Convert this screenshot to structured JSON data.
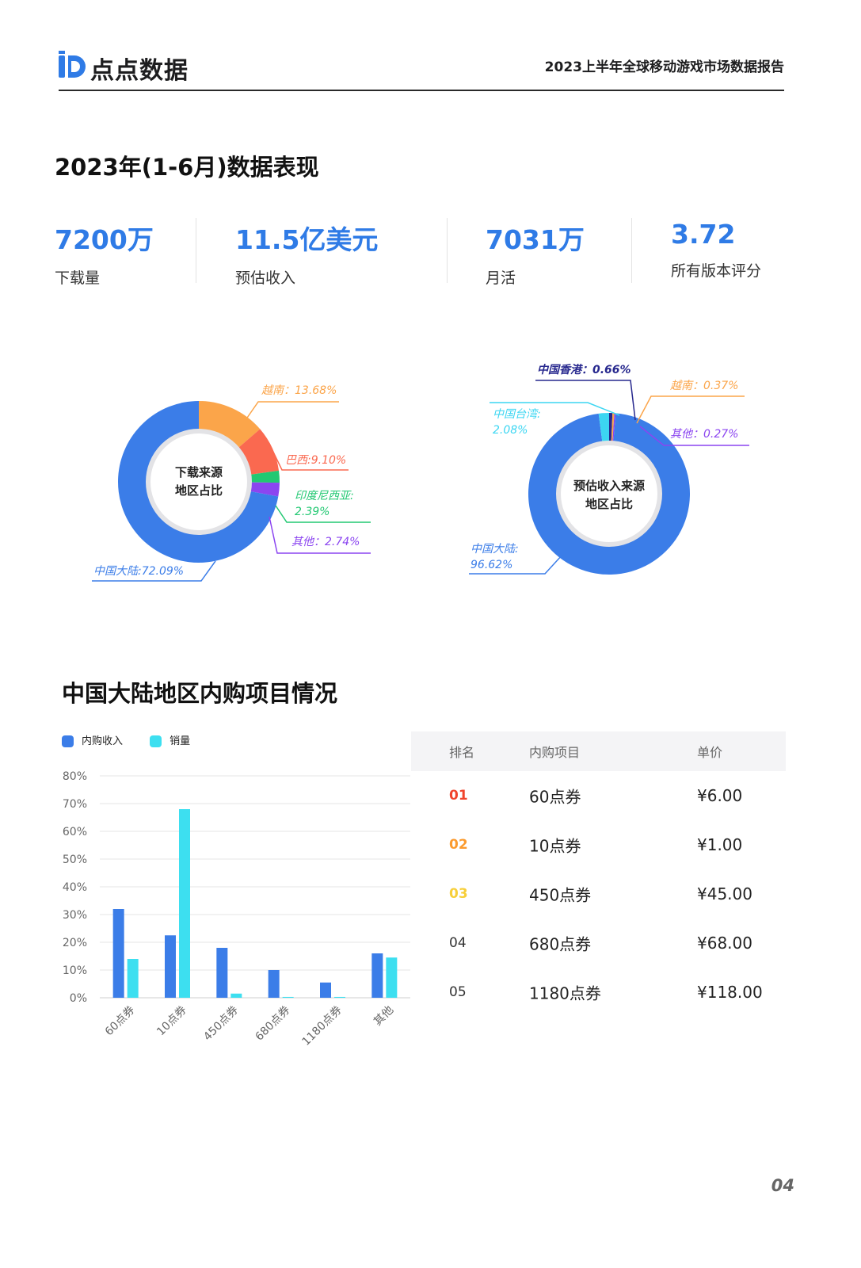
{
  "header": {
    "logo_text": "点点数据",
    "report_title": "2023上半年全球移动游戏市场数据报告"
  },
  "section1": {
    "title": "2023年(1-6月)数据表现"
  },
  "kpis": [
    {
      "value": "7200万",
      "label": "下载量"
    },
    {
      "value": "11.5亿美元",
      "label": "预估收入"
    },
    {
      "value": "7031万",
      "label": "月活"
    },
    {
      "value": "3.72",
      "label": "所有版本评分"
    }
  ],
  "donut_download": {
    "center_line1": "下载来源",
    "center_line2": "地区占比",
    "segments": [
      {
        "name": "中国大陆",
        "label": "中国大陆:72.09%",
        "value": 72.09,
        "color": "#3b7de8"
      },
      {
        "name": "越南",
        "label": "越南：13.68%",
        "value": 13.68,
        "color": "#fba54a"
      },
      {
        "name": "巴西",
        "label": "巴西:9.10%",
        "value": 9.1,
        "color": "#fa6950"
      },
      {
        "name": "印度尼西亚",
        "label_line1": "印度尼西亚:",
        "label_line2": "2.39%",
        "value": 2.39,
        "color": "#22c872"
      },
      {
        "name": "其他",
        "label": "其他：2.74%",
        "value": 2.74,
        "color": "#8b45f0"
      }
    ]
  },
  "donut_revenue": {
    "center_line1": "预估收入来源",
    "center_line2": "地区占比",
    "segments": [
      {
        "name": "中国大陆",
        "label_line1": "中国大陆:",
        "label_line2": "96.62%",
        "value": 96.62,
        "color": "#3b7de8"
      },
      {
        "name": "中国台湾",
        "label_line1": "中国台湾:",
        "label_line2": "2.08%",
        "value": 2.08,
        "color": "#3cd6f2"
      },
      {
        "name": "中国香港",
        "label": "中国香港：0.66%",
        "value": 0.66,
        "color": "#27288e"
      },
      {
        "name": "越南",
        "label": "越南：0.37%",
        "value": 0.37,
        "color": "#fba54a"
      },
      {
        "name": "其他",
        "label": "其他：0.27%",
        "value": 0.27,
        "color": "#8b45f0"
      }
    ]
  },
  "section2": {
    "title": "中国大陆地区内购项目情况"
  },
  "legend": [
    {
      "label": "内购收入",
      "color": "#3b7de8"
    },
    {
      "label": "销量",
      "color": "#3ddff0"
    }
  ],
  "chart_data": {
    "type": "bar",
    "categories": [
      "60点券",
      "10点券",
      "450点券",
      "680点券",
      "1180点券",
      "其他"
    ],
    "series": [
      {
        "name": "内购收入",
        "values": [
          32,
          22.5,
          18,
          10,
          5.5,
          16
        ]
      },
      {
        "name": "销量",
        "values": [
          14,
          68,
          1.5,
          0.3,
          0.3,
          14.5
        ]
      }
    ],
    "yticks": [
      "80%",
      "70%",
      "60%",
      "50%",
      "40%",
      "30%",
      "20%",
      "10%",
      "0%"
    ],
    "ylim": [
      0,
      80
    ],
    "grid": true,
    "legend_position": "top-left"
  },
  "table": {
    "headers": [
      "排名",
      "内购项目",
      "单价"
    ],
    "rows": [
      {
        "rank": "01",
        "item": "60点券",
        "price": "¥6.00",
        "rank_color": "#f0442c"
      },
      {
        "rank": "02",
        "item": "10点券",
        "price": "¥1.00",
        "rank_color": "#fb9b2f"
      },
      {
        "rank": "03",
        "item": "450点券",
        "price": "¥45.00",
        "rank_color": "#f7cf3a"
      },
      {
        "rank": "04",
        "item": "680点券",
        "price": "¥68.00",
        "rank_color": "#333333"
      },
      {
        "rank": "05",
        "item": "1180点券",
        "price": "¥118.00",
        "rank_color": "#333333"
      }
    ]
  },
  "page_number": "04"
}
